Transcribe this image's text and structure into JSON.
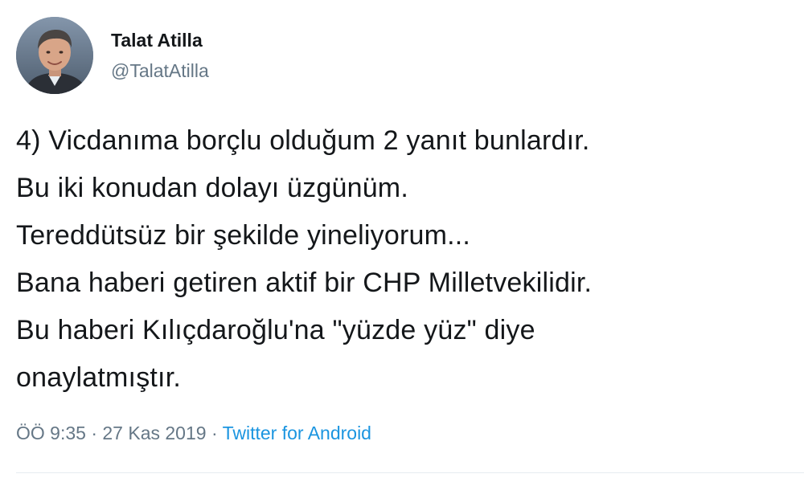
{
  "author": {
    "display_name": "Talat Atilla",
    "handle": "@TalatAtilla",
    "avatar_icon": "profile-photo"
  },
  "tweet": {
    "lines": [
      "4) Vicdanıma borçlu olduğum 2 yanıt bunlardır.",
      "Bu iki konudan dolayı üzgünüm.",
      "Tereddütsüz bir şekilde yineliyorum...",
      "Bana haberi getiren aktif bir CHP Milletvekilidir.",
      "Bu haberi Kılıçdaroğlu'na \"yüzde yüz\" diye",
      "onaylatmıştır."
    ]
  },
  "meta": {
    "time": "ÖÖ 9:35",
    "separator": "·",
    "date": "27 Kas 2019",
    "source": "Twitter for Android"
  },
  "colors": {
    "text": "#14171a",
    "secondary": "#657786",
    "link": "#1b95e0",
    "divider": "#e6ecf0"
  }
}
